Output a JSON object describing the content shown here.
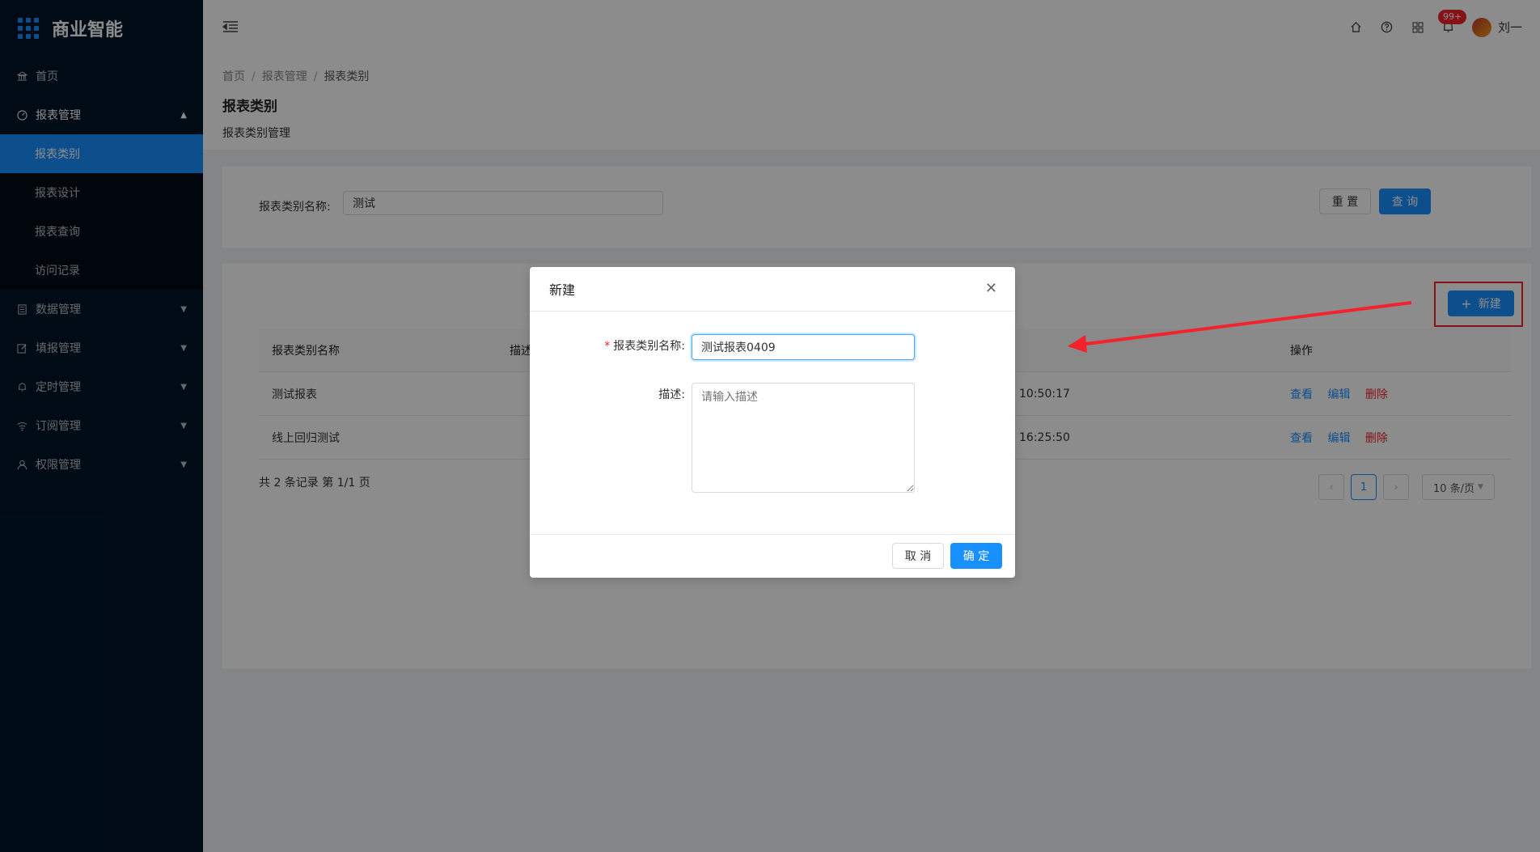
{
  "app": {
    "title": "商业智能"
  },
  "sidebar": {
    "items": [
      {
        "label": "首页",
        "icon": "bank-icon"
      },
      {
        "label": "报表管理",
        "icon": "dashboard-icon",
        "expanded": true,
        "children": [
          "报表类别",
          "报表设计",
          "报表查询",
          "访问记录"
        ],
        "active_child": "报表类别"
      },
      {
        "label": "数据管理",
        "icon": "database-icon"
      },
      {
        "label": "填报管理",
        "icon": "form-edit-icon"
      },
      {
        "label": "定时管理",
        "icon": "bell-icon"
      },
      {
        "label": "订阅管理",
        "icon": "wifi-icon"
      },
      {
        "label": "权限管理",
        "icon": "user-icon"
      }
    ]
  },
  "header": {
    "notification_badge": "99+",
    "user_name": "刘一"
  },
  "page": {
    "breadcrumb": [
      "首页",
      "报表管理",
      "报表类别"
    ],
    "title": "报表类别",
    "description": "报表类别管理"
  },
  "search": {
    "label": "报表类别名称:",
    "value": "测试",
    "reset_label": "重 置",
    "query_label": "查 询"
  },
  "table": {
    "new_button_label": "新建",
    "columns": [
      "报表类别名称",
      "描述",
      "",
      "操作"
    ],
    "rows": [
      {
        "name": "测试报表",
        "description": "",
        "time": "10:50:17",
        "actions": [
          "查看",
          "编辑",
          "删除"
        ]
      },
      {
        "name": "线上回归测试",
        "description": "",
        "time": "16:25:50",
        "actions": [
          "查看",
          "编辑",
          "删除"
        ]
      }
    ],
    "total_text": "共 2 条记录 第 1/1 页",
    "current_page": "1",
    "page_size": "10 条/页"
  },
  "modal": {
    "title": "新建",
    "name_label": "报表类别名称:",
    "name_value": "测试报表0409",
    "desc_label": "描述:",
    "desc_placeholder": "请输入描述",
    "cancel_label": "取 消",
    "ok_label": "确 定"
  },
  "colors": {
    "sidebar_bg": "#001529",
    "primary": "#1890ff",
    "danger": "#f5222d",
    "annotation": "#f5222d"
  }
}
